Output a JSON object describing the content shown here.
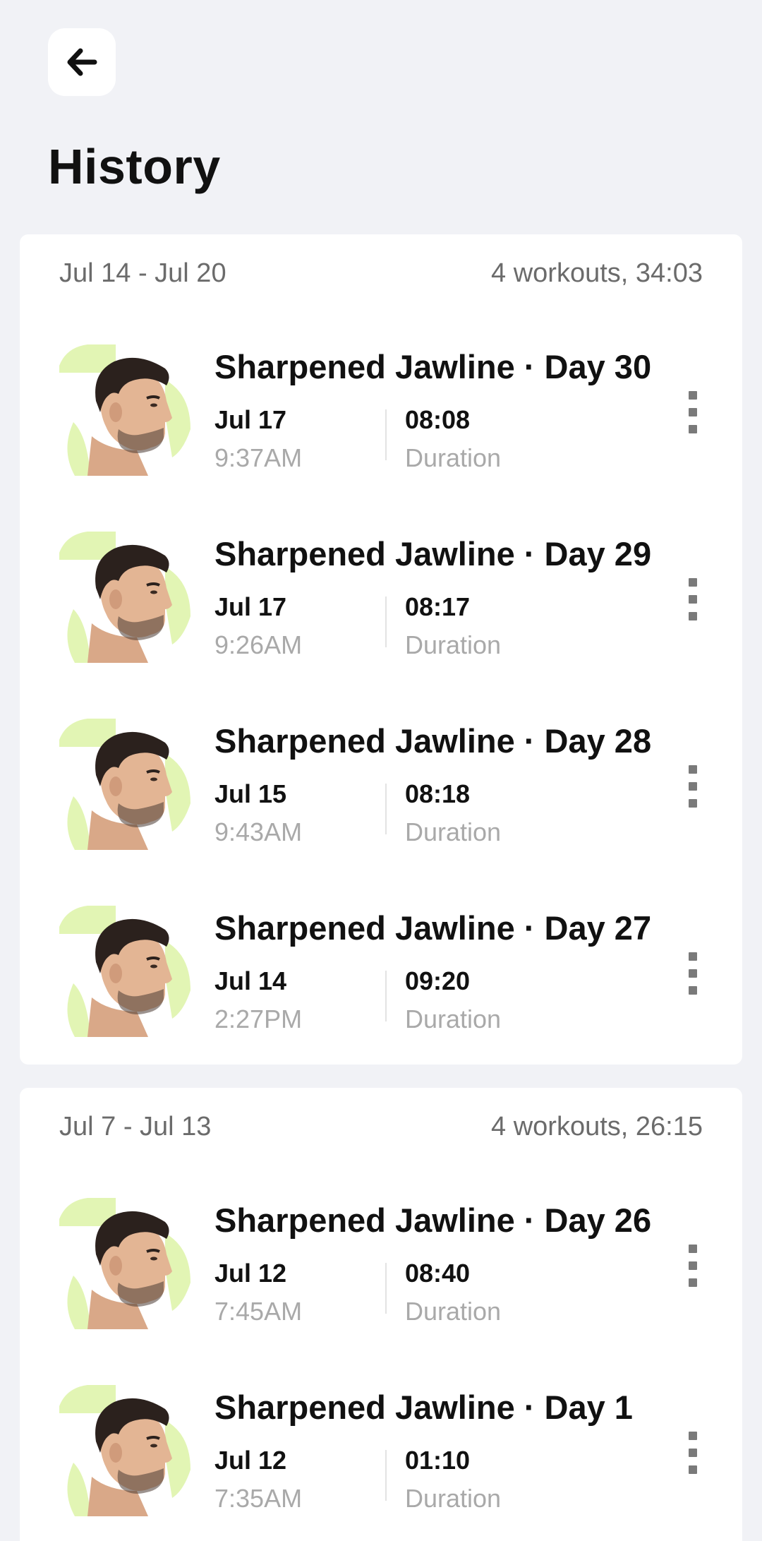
{
  "header": {
    "title": "History",
    "back_icon": "arrow-left-icon"
  },
  "weeks": [
    {
      "range": "Jul 14 - Jul 20",
      "summary": "4 workouts, 34:03",
      "workouts": [
        {
          "title": "Sharpened Jawline · Day 30",
          "date": "Jul 17",
          "time": "9:37AM",
          "duration": "08:08",
          "duration_label": "Duration"
        },
        {
          "title": "Sharpened Jawline · Day 29",
          "date": "Jul 17",
          "time": "9:26AM",
          "duration": "08:17",
          "duration_label": "Duration"
        },
        {
          "title": "Sharpened Jawline · Day 28",
          "date": "Jul 15",
          "time": "9:43AM",
          "duration": "08:18",
          "duration_label": "Duration"
        },
        {
          "title": "Sharpened Jawline · Day 27",
          "date": "Jul 14",
          "time": "2:27PM",
          "duration": "09:20",
          "duration_label": "Duration"
        }
      ]
    },
    {
      "range": "Jul 7 - Jul 13",
      "summary": "4 workouts, 26:15",
      "workouts": [
        {
          "title": "Sharpened Jawline · Day 26",
          "date": "Jul 12",
          "time": "7:45AM",
          "duration": "08:40",
          "duration_label": "Duration"
        },
        {
          "title": "Sharpened Jawline · Day 1",
          "date": "Jul 12",
          "time": "7:35AM",
          "duration": "01:10",
          "duration_label": "Duration"
        }
      ]
    }
  ],
  "colors": {
    "accent_green": "#e2f5b4",
    "background": "#f1f2f6",
    "card": "#ffffff",
    "muted_text": "#a9a9a9"
  }
}
